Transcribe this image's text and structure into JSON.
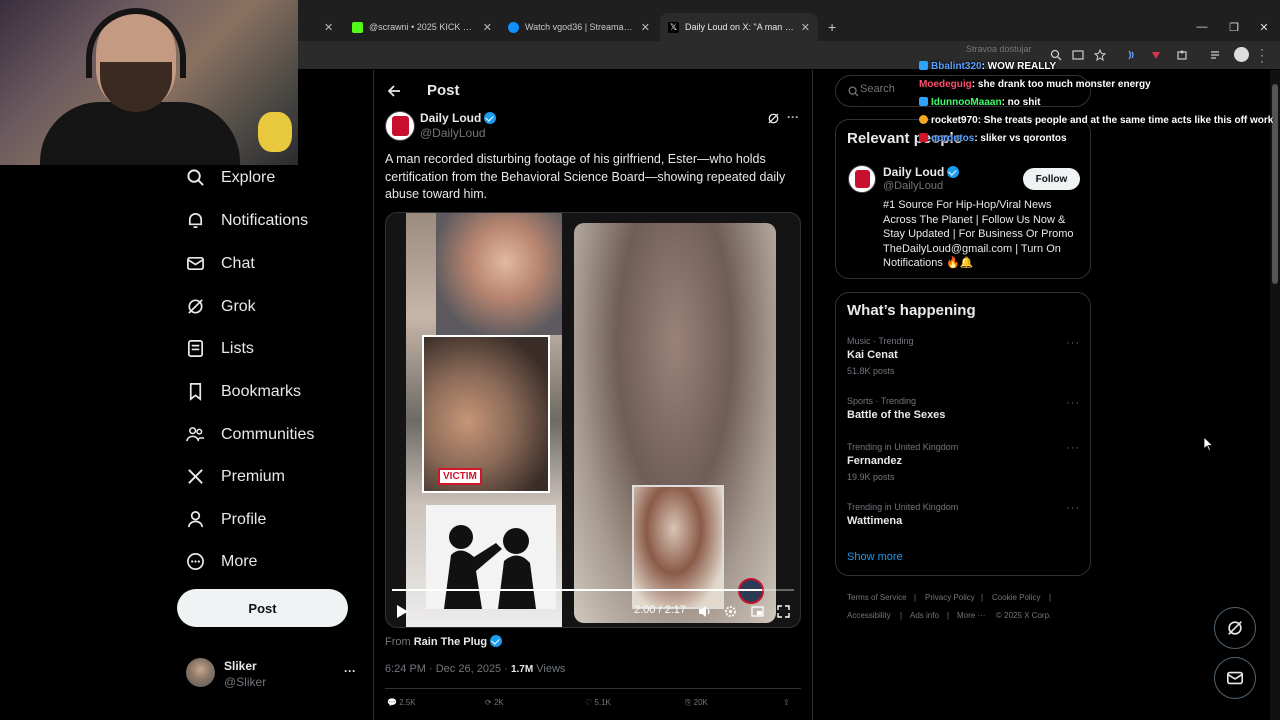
{
  "browser": {
    "tabs": [
      {
        "label": "@scrawni • 2025 KICK WRAPP…",
        "icon": "kick-favicon"
      },
      {
        "label": "Watch vgod36 | Streamable",
        "icon": "streamable-favicon"
      },
      {
        "label": "Daily Loud on X: \"A man record…",
        "icon": "x-favicon"
      }
    ],
    "new_tab": "+",
    "window_controls": [
      "—",
      "❐",
      "✕"
    ],
    "address_overlay": "Stravoa dostujar"
  },
  "sidebar": {
    "items": [
      {
        "label": "Explore",
        "icon": "search-icon"
      },
      {
        "label": "Notifications",
        "icon": "bell-icon"
      },
      {
        "label": "Chat",
        "icon": "mail-icon"
      },
      {
        "label": "Grok",
        "icon": "grok-icon"
      },
      {
        "label": "Lists",
        "icon": "list-icon"
      },
      {
        "label": "Bookmarks",
        "icon": "bookmark-icon"
      },
      {
        "label": "Communities",
        "icon": "communities-icon"
      },
      {
        "label": "Premium",
        "icon": "x-logo-icon"
      },
      {
        "label": "Profile",
        "icon": "person-icon"
      },
      {
        "label": "More",
        "icon": "more-circle-icon"
      }
    ],
    "post_button": "Post",
    "account": {
      "name": "Sliker",
      "handle": "@Sliker",
      "menu": "···"
    }
  },
  "post": {
    "header": "Post",
    "author": {
      "name": "Daily Loud",
      "handle": "@DailyLoud"
    },
    "text": "A man recorded disturbing footage of his girlfriend, Ester—who holds certification from the Behavioral Science Board—showing repeated daily abuse toward him.",
    "video": {
      "time": "2:00 / 2:17",
      "progress": 0.92,
      "victim_label": "VICTIM"
    },
    "from_prefix": "From",
    "from_account": "Rain The Plug",
    "timestamp": "6:24 PM · Dec 26, 2025 ·",
    "views_count": "1.7M",
    "views_label": "Views",
    "action_counts": [
      "2.5K",
      "2K",
      "5.1K",
      "20K"
    ]
  },
  "right": {
    "search_placeholder": "Search",
    "relevant_title": "Relevant people",
    "relevant": {
      "name": "Daily Loud",
      "handle": "@DailyLoud",
      "follow": "Follow",
      "bio": "#1 Source For Hip-Hop/Viral News Across The Planet | Follow Us Now & Stay Updated | For Business Or Promo TheDailyLoud@gmail.com | Turn On Notifications 🔥🔔"
    },
    "happening_title": "What’s happening",
    "trends": [
      {
        "meta": "Music · Trending",
        "name": "Kai Cenat",
        "count": "51.8K posts"
      },
      {
        "meta": "Sports · Trending",
        "name": "Battle of the Sexes",
        "count": ""
      },
      {
        "meta": "Trending in United Kingdom",
        "name": "Fernandez",
        "count": "19.9K posts"
      },
      {
        "meta": "Trending in United Kingdom",
        "name": "Wattimena",
        "count": ""
      }
    ],
    "show_more": "Show more",
    "footer": [
      "Terms of Service",
      "|",
      "Privacy Policy",
      "|",
      "Cookie Policy",
      "|",
      "Accessibility",
      "|",
      "Ads info",
      "|",
      "More ···",
      "© 2025 X Corp."
    ]
  },
  "chat": [
    {
      "user": "Bbalint320",
      "msg": ": WOW REALLY",
      "color": "#5aa0ff"
    },
    {
      "user": "Moedeguig",
      "msg": ": she drank too much monster energy",
      "color": "#ff4d6d"
    },
    {
      "user": "IdunnooMaaan",
      "msg": ": no shit",
      "color": "#3dff6a"
    },
    {
      "user": "rocket970",
      "msg": ": She treats people and at the same time acts like this off work",
      "color": "#ffffff"
    },
    {
      "user": "qorontos",
      "msg": ": sliker vs qorontos",
      "color": "#5aa0ff"
    }
  ],
  "colors": {
    "accent": "#1d9bf0",
    "bg": "#000000",
    "border": "#2f3336",
    "muted": "#71767b"
  }
}
